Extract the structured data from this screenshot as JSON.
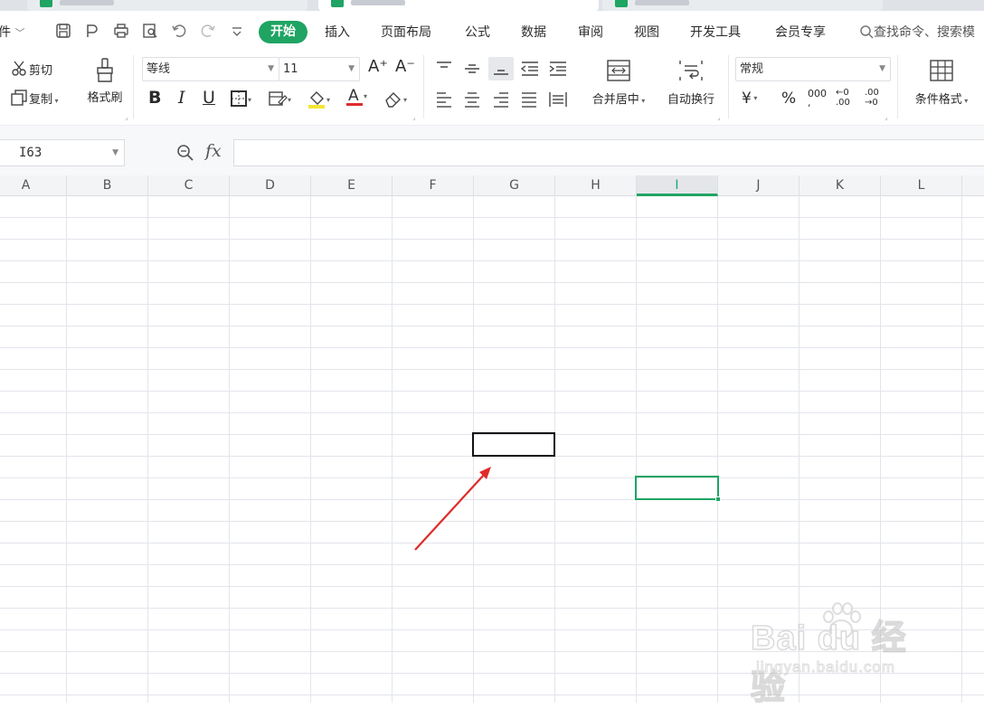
{
  "menu": {
    "file": "件",
    "file_chevron": "﹀",
    "start": "开始",
    "insert": "插入",
    "page_layout": "页面布局",
    "formula": "公式",
    "data": "数据",
    "review": "审阅",
    "view": "视图",
    "developer": "开发工具",
    "member": "会员专享",
    "search_placeholder": "查找命令、搜索模"
  },
  "ribbon": {
    "cut": "剪切",
    "copy": "复制",
    "format_painter": "格式刷",
    "font_name": "等线",
    "font_size": "11",
    "grow_font": "A⁺",
    "shrink_font": "A⁻",
    "bold": "B",
    "italic": "I",
    "underline": "U",
    "merge_center": "合并居中",
    "wrap_text": "自动换行",
    "number_format": "常规",
    "currency": "¥",
    "percent": "%",
    "thousands": "000",
    "inc_decimal": "←0\n.00",
    "dec_decimal": ".00\n→0",
    "cond_format": "条件格式"
  },
  "formula_bar": {
    "name_box": "I63",
    "fx": "fx",
    "value": ""
  },
  "columns": [
    "A",
    "B",
    "C",
    "D",
    "E",
    "F",
    "G",
    "H",
    "I",
    "J",
    "K",
    "L"
  ],
  "selected_column": "I",
  "watermark": {
    "main": "Bai  du 经验",
    "sub": "jingyan.baidu.com"
  },
  "colors": {
    "accent": "#1fa463",
    "arrow": "#e02a2a"
  }
}
